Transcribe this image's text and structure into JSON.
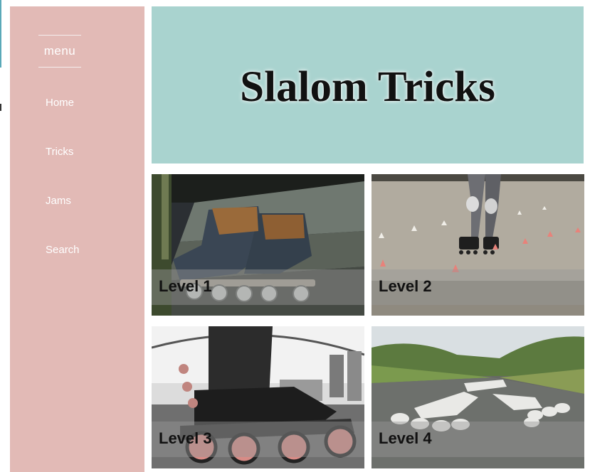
{
  "sidebar": {
    "menu_label": "menu",
    "items": [
      {
        "label": "Home"
      },
      {
        "label": "Tricks"
      },
      {
        "label": "Jams"
      },
      {
        "label": "Search"
      }
    ]
  },
  "header": {
    "title": "Slalom Tricks"
  },
  "tiles": [
    {
      "label": "Level 1",
      "image": "inline-skates-on-steps-photo"
    },
    {
      "label": "Level 2",
      "image": "skater-between-cones-photo"
    },
    {
      "label": "Level 3",
      "image": "skate-closeup-wheels-photo"
    },
    {
      "label": "Level 4",
      "image": "path-with-skate-symbol-photo"
    }
  ],
  "colors": {
    "sidebar_bg": "#e2bab6",
    "header_bg": "#a9d3cf",
    "text_light": "#ffffff",
    "title_text": "#111111"
  }
}
